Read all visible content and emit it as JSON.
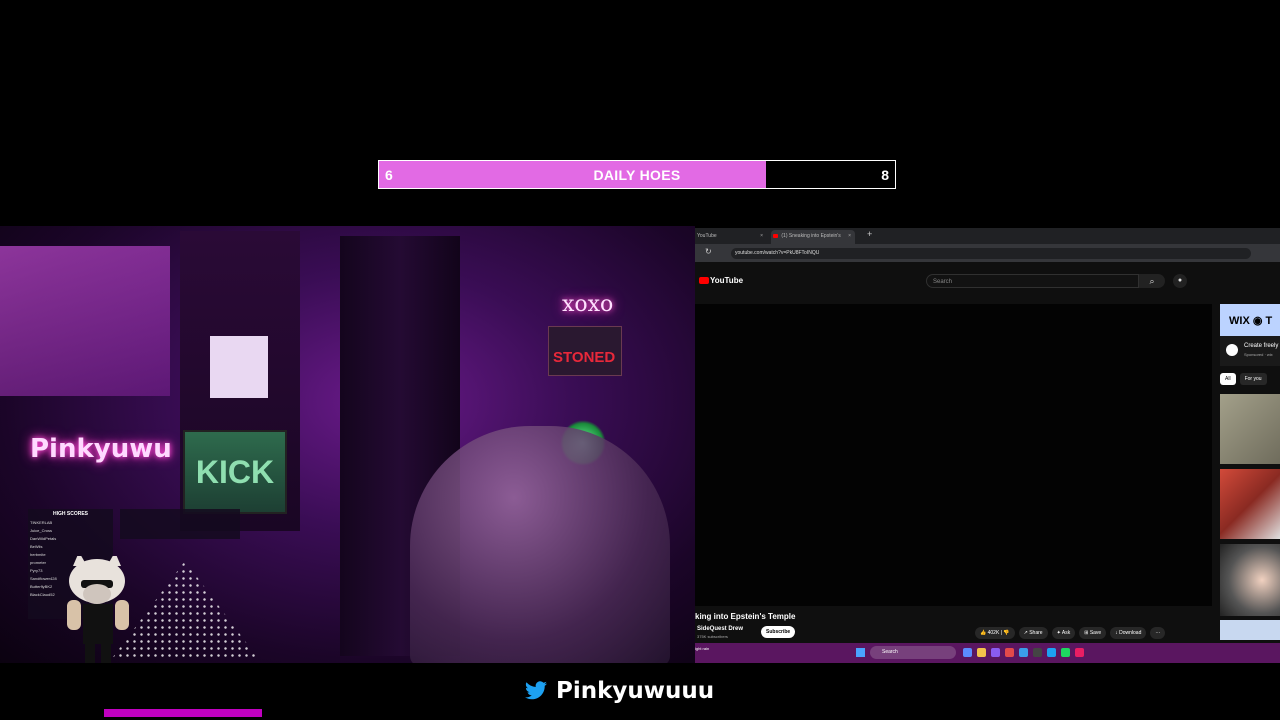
{
  "goal": {
    "current": "6",
    "title": "DAILY HOES",
    "target": "8",
    "progress_fraction": 0.75,
    "fill_color": "#e26ae4"
  },
  "webcam": {
    "neon_sign_name": "Pinkyuwu",
    "neon_sign_xoxo": "xoxo",
    "neon_sign_stoned": "STONED",
    "monitor_text": "KICK",
    "scores_title": "HIGH SCORES",
    "player_rows": [
      "TINKERLAB",
      "Juice_Cross",
      "DanWildPetals",
      "BeWils",
      "herbmite",
      "prometer",
      "Pyry73",
      "Sandflower428",
      "ButterflyBK2",
      "BlackClaud52"
    ]
  },
  "browser": {
    "tab1": "YouTube",
    "tab2": "(1) Sneaking into Epstein's",
    "new_tab": "+",
    "url": "youtube.com/watch?v=PkU8FToINQU",
    "yt_logo": "YouTube",
    "search_placeholder": "Search",
    "video_title": "king into Epstein's Temple",
    "channel_name": "SideQuest Drew",
    "subscriber_count": "375K subscribers",
    "subscribe_label": "Subscribe",
    "actions": {
      "likes": "402K",
      "share": "Share",
      "ask": "Ask",
      "save": "Save",
      "download": "Download",
      "more": "···"
    },
    "ad": {
      "brand": "WIX ◉ T",
      "line1": "Create freely",
      "line2": "Sponsored · wix"
    },
    "chips": [
      "All",
      "For you"
    ],
    "taskbar": {
      "weather": "ight rain",
      "search": "Search"
    },
    "icons": [
      "reload-icon",
      "search-icon",
      "mic-icon",
      "windows-start-icon"
    ]
  },
  "bottom": {
    "handle": "Pinkyuwuuu",
    "icon": "twitter-bird-icon"
  }
}
